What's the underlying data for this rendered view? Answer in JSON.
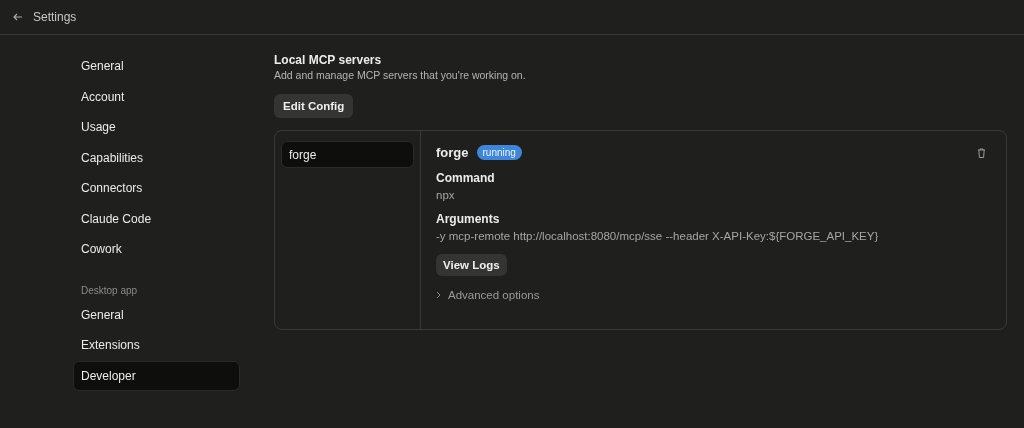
{
  "window": {
    "title": "Settings"
  },
  "sidebar": {
    "groups": [
      {
        "items": [
          {
            "label": "General",
            "selected": false
          },
          {
            "label": "Account",
            "selected": false
          },
          {
            "label": "Usage",
            "selected": false
          },
          {
            "label": "Capabilities",
            "selected": false
          },
          {
            "label": "Connectors",
            "selected": false
          },
          {
            "label": "Claude Code",
            "selected": false
          },
          {
            "label": "Cowork",
            "selected": false
          }
        ]
      },
      {
        "heading": "Desktop app",
        "items": [
          {
            "label": "General",
            "selected": false
          },
          {
            "label": "Extensions",
            "selected": false
          },
          {
            "label": "Developer",
            "selected": true
          }
        ]
      }
    ]
  },
  "section": {
    "title": "Local MCP servers",
    "description": "Add and manage MCP servers that you're working on.",
    "button": "Edit Config"
  },
  "servers": [
    {
      "name": "forge",
      "selected": true
    }
  ],
  "detail": {
    "name": "forge",
    "status": {
      "label": "running",
      "kind": "running"
    },
    "fields": [
      {
        "label": "Command",
        "value": "npx"
      },
      {
        "label": "Arguments",
        "value": "-y mcp-remote http://localhost:8080/mcp/sse --header X-API-Key:${FORGE_API_KEY}"
      }
    ],
    "button": "View Logs",
    "advanced": {
      "label": "Advanced options",
      "expanded": false
    }
  }
}
